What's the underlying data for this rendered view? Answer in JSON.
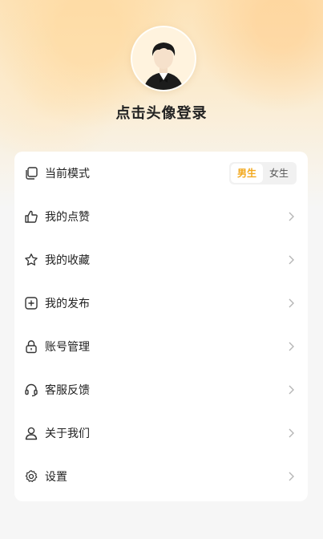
{
  "profile": {
    "login_prompt": "点击头像登录"
  },
  "mode": {
    "label": "当前模式",
    "options": [
      "男生",
      "女生"
    ],
    "selected": "男生",
    "accent_color": "#f2a81d"
  },
  "menu": [
    {
      "label": "我的点赞",
      "icon": "thumbs-up-icon"
    },
    {
      "label": "我的收藏",
      "icon": "star-icon"
    },
    {
      "label": "我的发布",
      "icon": "plus-square-icon"
    },
    {
      "label": "账号管理",
      "icon": "lock-icon"
    },
    {
      "label": "客服反馈",
      "icon": "headset-icon"
    },
    {
      "label": "关于我们",
      "icon": "person-icon"
    },
    {
      "label": "设置",
      "icon": "gear-icon"
    }
  ]
}
